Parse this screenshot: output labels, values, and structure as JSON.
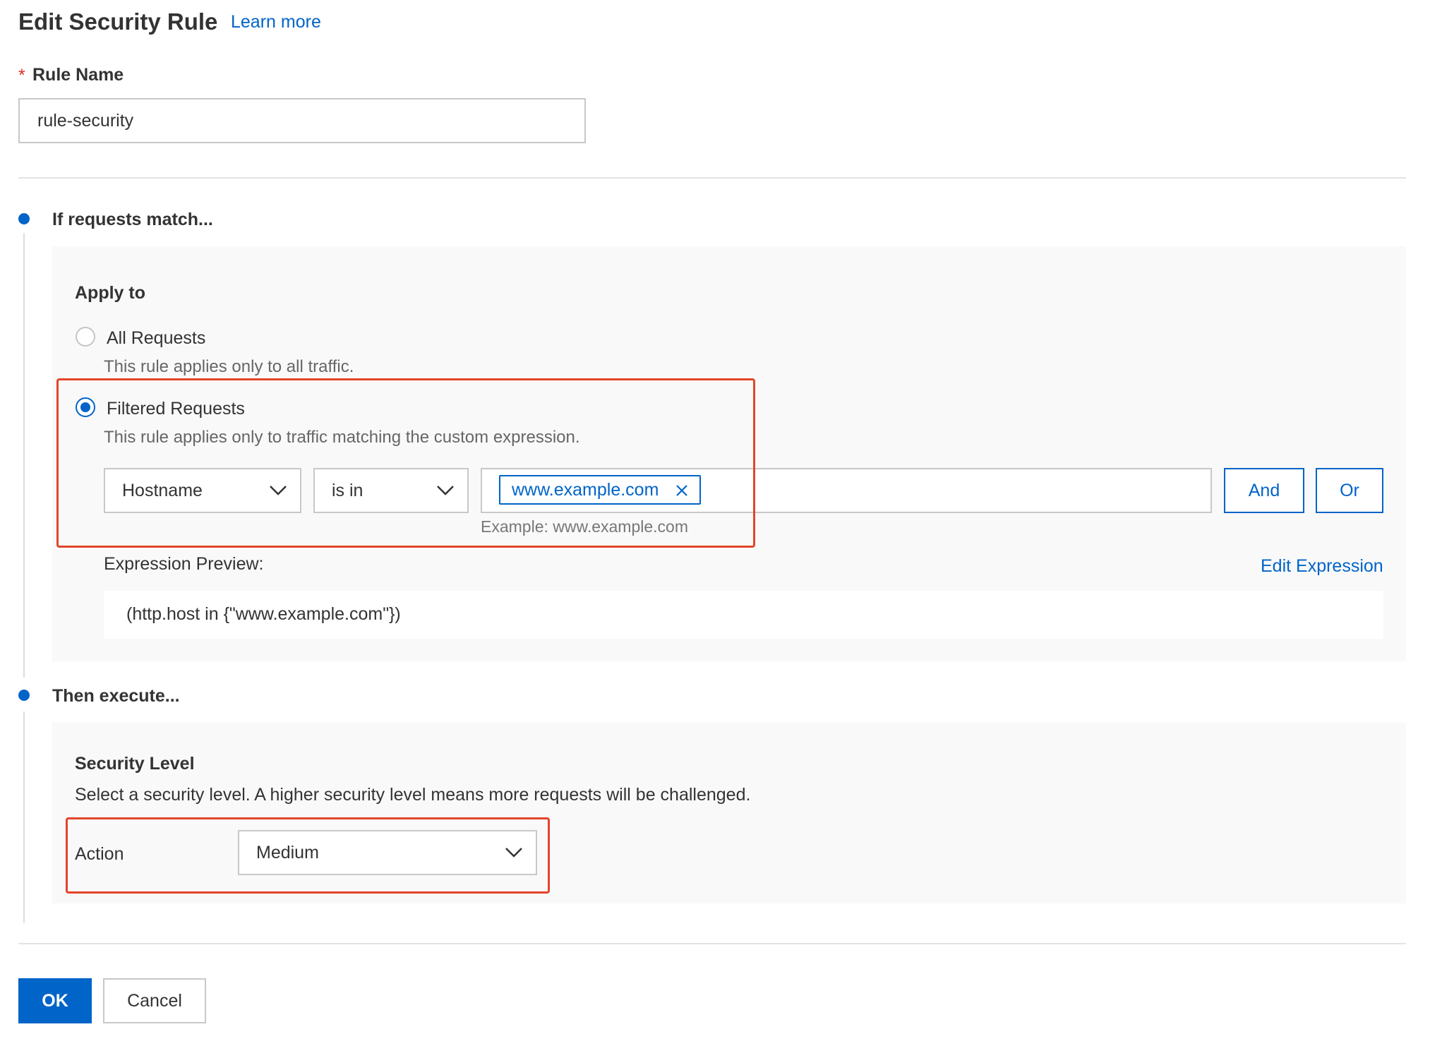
{
  "header": {
    "title": "Edit Security Rule",
    "learn_more": "Learn more"
  },
  "rule_name": {
    "required_mark": "*",
    "label": "Rule Name",
    "value": "rule-security"
  },
  "match_step": {
    "title": "If requests match...",
    "apply_to": {
      "label": "Apply to",
      "options": [
        {
          "label": "All Requests",
          "description": "This rule applies only to all traffic.",
          "selected": false
        },
        {
          "label": "Filtered Requests",
          "description": "This rule applies only to traffic matching the custom expression.",
          "selected": true
        }
      ]
    },
    "condition": {
      "field": "Hostname",
      "operator": "is in",
      "values": [
        "www.example.com"
      ],
      "hint": "Example: www.example.com",
      "and_label": "And",
      "or_label": "Or"
    },
    "preview": {
      "label": "Expression Preview:",
      "edit_label": "Edit Expression",
      "expression": "(http.host in {\"www.example.com\"})"
    }
  },
  "execute_step": {
    "title": "Then execute...",
    "security_level": {
      "title": "Security Level",
      "description": "Select a security level. A higher security level means more requests will be challenged.",
      "action_label": "Action",
      "action_value": "Medium"
    }
  },
  "footer": {
    "ok_label": "OK",
    "cancel_label": "Cancel"
  },
  "colors": {
    "accent": "#0064c8",
    "highlight": "#e2452b",
    "required": "#d93026"
  }
}
